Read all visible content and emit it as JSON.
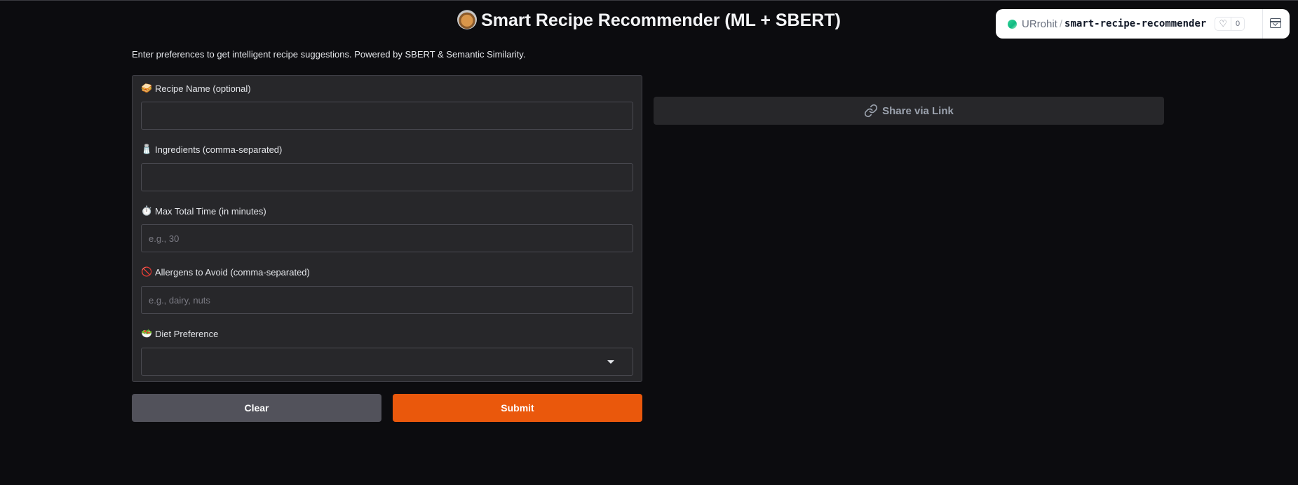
{
  "page": {
    "title": "Smart Recipe Recommender (ML + SBERT)",
    "title_icon": "paella-icon",
    "subtitle": "Enter preferences to get intelligent recipe suggestions. Powered by SBERT & Semantic Similarity."
  },
  "hf_badge": {
    "user": "URrohit",
    "separator": "/",
    "space": "smart-recipe-recommender",
    "likes": "0",
    "status_color": "#34d399"
  },
  "form": {
    "recipe_name": {
      "icon": "🥪",
      "label": "Recipe Name (optional)",
      "value": "",
      "placeholder": ""
    },
    "ingredients": {
      "icon": "🧂",
      "label": "Ingredients (comma-separated)",
      "value": "",
      "placeholder": ""
    },
    "max_time": {
      "icon": "⏱️",
      "label": "Max Total Time (in minutes)",
      "value": "",
      "placeholder": "e.g., 30"
    },
    "allergens": {
      "icon": "🚫",
      "label": "Allergens to Avoid (comma-separated)",
      "value": "",
      "placeholder": "e.g., dairy, nuts"
    },
    "diet": {
      "icon": "🥗",
      "label": "Diet Preference",
      "selected": ""
    }
  },
  "buttons": {
    "clear": "Clear",
    "submit": "Submit",
    "share": "Share via Link"
  },
  "colors": {
    "accent": "#ea580c",
    "secondary_button": "#52525b",
    "background": "#0c0c0f",
    "panel": "#27272a"
  }
}
